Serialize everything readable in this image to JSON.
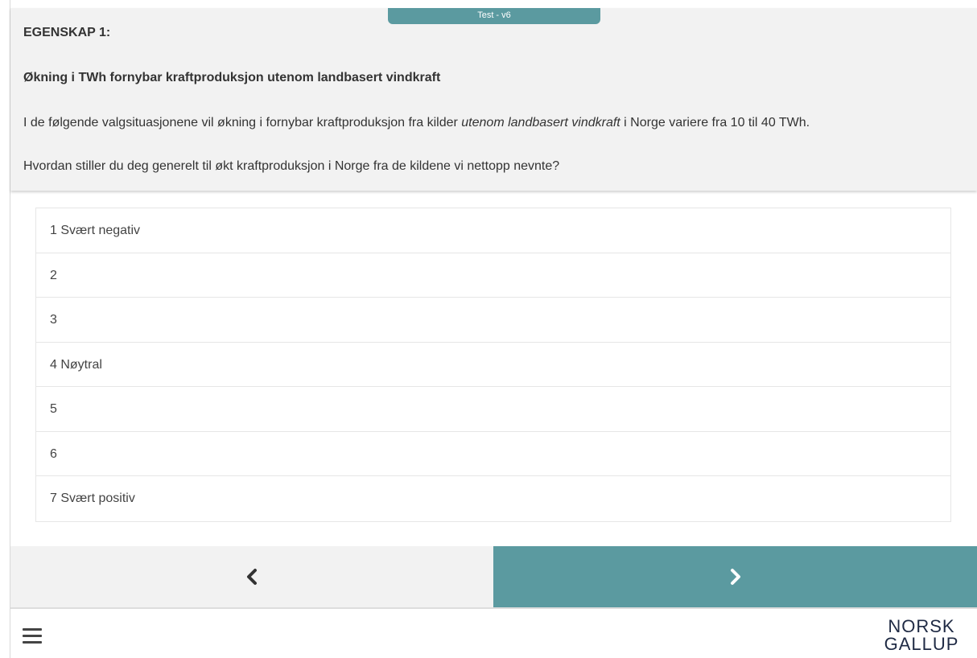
{
  "header": {
    "version_tab": "Test - v6"
  },
  "question": {
    "heading": "EGENSKAP 1:",
    "subheading": "Økning i TWh fornybar kraftproduksjon utenom landbasert vindkraft",
    "intro_before": "I de følgende valgsituasjonene vil økning i fornybar kraftproduksjon fra kilder ",
    "intro_emphasis": "utenom landbasert vindkraft",
    "intro_after": " i Norge variere fra 10 til 40 TWh.",
    "prompt": "Hvordan stiller du deg generelt til økt kraftproduksjon i Norge fra de kildene vi nettopp nevnte?"
  },
  "options": [
    {
      "label": "1 Svært negativ"
    },
    {
      "label": "2"
    },
    {
      "label": "3"
    },
    {
      "label": "4 Nøytral"
    },
    {
      "label": "5"
    },
    {
      "label": "6"
    },
    {
      "label": "7 Svært positiv"
    }
  ],
  "navigation": {
    "back_icon": "chevron-left-icon",
    "next_icon": "chevron-right-icon"
  },
  "footer": {
    "menu_icon": "hamburger-menu-icon",
    "logo_line1": "NORSK",
    "logo_line2": "GALLUP"
  },
  "colors": {
    "accent": "#5b9aa0",
    "panel_background": "#f2f2f2",
    "text": "#333333",
    "logo": "#1f2a44"
  }
}
